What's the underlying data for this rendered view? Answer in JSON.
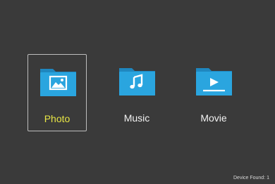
{
  "colors": {
    "background": "#3a3a3a",
    "folder": "#2aa5df",
    "folder_tab": "#1f87bf",
    "accent": "#e8e645",
    "label": "#f2f2f2"
  },
  "media_menu": {
    "selected": "photo",
    "items": [
      {
        "id": "photo",
        "label": "Photo",
        "icon": "photo-folder-icon"
      },
      {
        "id": "music",
        "label": "Music",
        "icon": "music-folder-icon"
      },
      {
        "id": "movie",
        "label": "Movie",
        "icon": "movie-folder-icon"
      }
    ]
  },
  "status": {
    "device_found_label": "Device Found:",
    "device_found_count": "1"
  }
}
